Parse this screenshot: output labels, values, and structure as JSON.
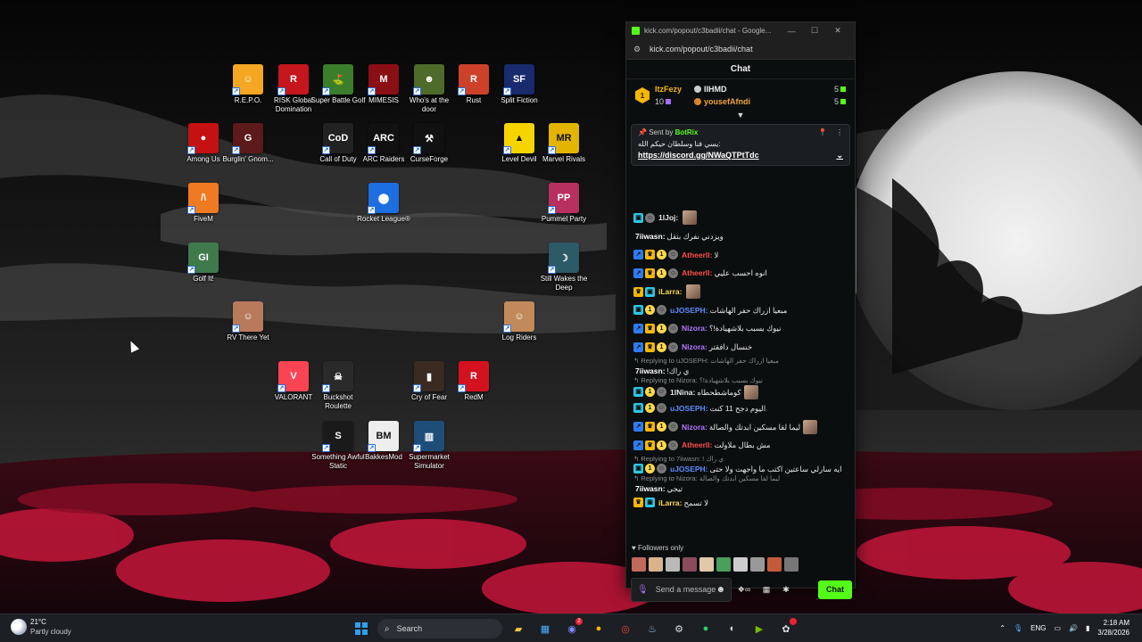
{
  "desktop": {
    "icons": [
      {
        "label": "R.E.P.O.",
        "color": "#f5a623",
        "glyph": "☺"
      },
      {
        "label": "RISK Global Domination",
        "color": "#c4161c",
        "glyph": "R"
      },
      {
        "label": "Super Battle Golf",
        "color": "#3a7d2a",
        "glyph": "⛳"
      },
      {
        "label": "MIMESIS",
        "color": "#8a0f14",
        "glyph": "M"
      },
      {
        "label": "Who's at the door",
        "color": "#4e6b2a",
        "glyph": "☻"
      },
      {
        "label": "Rust",
        "color": "#cd412b",
        "glyph": "R"
      },
      {
        "label": "Split Fiction",
        "color": "#1a2a6e",
        "glyph": "SF"
      },
      {
        "label": "Among Us",
        "color": "#c51111",
        "glyph": "●"
      },
      {
        "label": "Burglin' Gnom...",
        "color": "#5c1a1a",
        "glyph": "G"
      },
      {
        "label": "Call of Duty",
        "color": "#222222",
        "glyph": "CoD"
      },
      {
        "label": "ARC Raiders",
        "color": "#111111",
        "glyph": "ARC"
      },
      {
        "label": "CurseForge",
        "color": "#111111",
        "glyph": "⚒"
      },
      {
        "label": "Level Devil",
        "color": "#f5d400",
        "glyph": "▲"
      },
      {
        "label": "Marvel Rivals",
        "color": "#e3b400",
        "glyph": "MR"
      },
      {
        "label": "FiveM",
        "color": "#f07a22",
        "glyph": "/\\"
      },
      {
        "label": "Rocket League®",
        "color": "#1d6ee0",
        "glyph": "⬤"
      },
      {
        "label": "Pummel Party",
        "color": "#b83060",
        "glyph": "PP"
      },
      {
        "label": "Golf It!",
        "color": "#3f7a4d",
        "glyph": "GI"
      },
      {
        "label": "Still Wakes the Deep",
        "color": "#2c5a66",
        "glyph": "☽"
      },
      {
        "label": "RV There Yet",
        "color": "#b97a5c",
        "glyph": "☺"
      },
      {
        "label": "Log Riders",
        "color": "#c28a5a",
        "glyph": "☺"
      },
      {
        "label": "VALORANT",
        "color": "#fa4454",
        "glyph": "V"
      },
      {
        "label": "Buckshot Roulette",
        "color": "#2a2a2a",
        "glyph": "☠"
      },
      {
        "label": "Cry of Fear",
        "color": "#3a2a22",
        "glyph": "▮"
      },
      {
        "label": "RedM",
        "color": "#d4121f",
        "glyph": "R"
      },
      {
        "label": "Something Awful Static",
        "color": "#1a1a1a",
        "glyph": "S"
      },
      {
        "label": "BakkesMod",
        "color": "#eeeeee",
        "glyph": "BM"
      },
      {
        "label": "Supermarket Simulator",
        "color": "#1f4d7a",
        "glyph": "▥"
      }
    ]
  },
  "chat_window": {
    "window_title": "kick.com/popout/c3badii/chat - Google...",
    "url": "kick.com/popout/c3badii/chat",
    "header": "Chat",
    "leaderboard": {
      "first": {
        "name": "ItzFezy",
        "points": "10",
        "rank": "1"
      },
      "second": {
        "name": "IIHMD",
        "points": "5"
      },
      "third": {
        "name": "yousefAfndi",
        "points": "5"
      }
    },
    "pinned": {
      "sent_by_label": "Sent by",
      "sender": "BotRix",
      "text": ":يسي فنا وسلطان حيكم الله",
      "link": "https://discord.gg/NWaQTPtTdc"
    },
    "messages": [
      {
        "kind": "msg",
        "badges": [
          "og",
          "emo"
        ],
        "user": "1lJoj:",
        "user_color": "#e6e6e6",
        "text": "",
        "emote": true
      },
      {
        "kind": "msg",
        "badges": [],
        "user": "7iiwasn:",
        "user_color": "#ffffff",
        "text": "ويزدني نفرك بتقل"
      },
      {
        "kind": "msg",
        "badges": [
          "vip",
          "crown",
          "sub",
          "emo"
        ],
        "user": "Atheerll:",
        "user_color": "#ff4d4d",
        "text": "لا"
      },
      {
        "kind": "msg",
        "badges": [
          "vip",
          "crown",
          "sub",
          "emo"
        ],
        "user": "Atheerll:",
        "user_color": "#ff4d4d",
        "text": "انوه احسب عليي"
      },
      {
        "kind": "msg",
        "badges": [
          "crown",
          "og"
        ],
        "user": "iLarra:",
        "user_color": "#ffd84a",
        "text": "",
        "emote": true
      },
      {
        "kind": "msg",
        "badges": [
          "og",
          "sub",
          "emo"
        ],
        "user": "uJOSEPH:",
        "user_color": "#5e8cff",
        "text": "مبعيا ازراك حفر الهاشات"
      },
      {
        "kind": "msg",
        "badges": [
          "vip",
          "crown",
          "sub",
          "emo"
        ],
        "user": "Nizora:",
        "user_color": "#b178ff",
        "text": "نيوك بسبب بلاشهيادة!؟"
      },
      {
        "kind": "msg",
        "badges": [
          "vip",
          "crown",
          "sub",
          "emo"
        ],
        "user": "Nizora:",
        "user_color": "#b178ff",
        "text": "خنسال دافقتر"
      },
      {
        "kind": "reply",
        "text": "↰ Replying to uJOSEPH: مبعيا ازراك حفر الهاشات"
      },
      {
        "kind": "msg",
        "badges": [],
        "user": "7iiwasn:",
        "user_color": "#ffffff",
        "text": "!ي راك"
      },
      {
        "kind": "reply",
        "text": "↰ Replying to Nizora: نيوك بسبب بلاشهيادة!؟"
      },
      {
        "kind": "msg",
        "badges": [
          "og",
          "sub",
          "emo"
        ],
        "user": "1lNina:",
        "user_color": "#e6e6e6",
        "text": "كوماشطحطاه",
        "emote": true
      },
      {
        "kind": "msg",
        "badges": [
          "og",
          "sub",
          "emo"
        ],
        "user": "uJOSEPH:",
        "user_color": "#5e8cff",
        "text": "اليوم دجح 11 كنت"
      },
      {
        "kind": "msg",
        "badges": [
          "vip",
          "crown",
          "sub",
          "emo"
        ],
        "user": "Nizora:",
        "user_color": "#b178ff",
        "text": "ليما لقا مسكين ابدتك والصالة",
        "emote": true
      },
      {
        "kind": "msg",
        "badges": [
          "vip",
          "crown",
          "sub",
          "emo"
        ],
        "user": "Atheerll:",
        "user_color": "#ff4d4d",
        "text": "مش بطال ملاولت"
      },
      {
        "kind": "reply",
        "text": "↰ Replying to 7iiwasn: ! ي راك"
      },
      {
        "kind": "msg",
        "badges": [
          "og",
          "sub",
          "emo"
        ],
        "user": "uJOSEPH:",
        "user_color": "#5e8cff",
        "text": "ايه سارلي ساعتين اكتب ما واجهت ولا حتى"
      },
      {
        "kind": "reply",
        "text": "↰ Replying to Nizora: ليما لقا مسكين ابدتك والصالة"
      },
      {
        "kind": "msg",
        "badges": [],
        "user": "7iiwasn:",
        "user_color": "#ffffff",
        "text": "تيجي"
      },
      {
        "kind": "msg",
        "badges": [
          "crown",
          "og"
        ],
        "user": "iLarra:",
        "user_color": "#ffd84a",
        "text": "لا تسمح"
      }
    ],
    "followers_only": "Followers only",
    "input_placeholder": "Send a message",
    "send_label": "Chat"
  },
  "taskbar": {
    "weather_temp": "21°C",
    "weather_desc": "Partly cloudy",
    "search_placeholder": "Search",
    "language": "ENG",
    "time": "2:18 AM",
    "date": "3/28/2026"
  }
}
